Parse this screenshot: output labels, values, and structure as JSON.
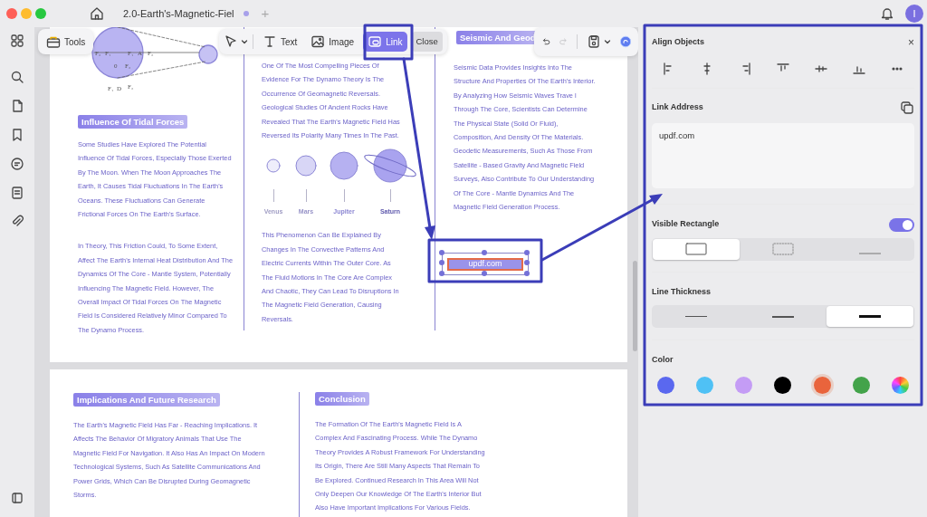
{
  "title_bar": {
    "tab_title": "2.0-Earth's-Magnetic-Fiel",
    "tab_unsaved": true,
    "new_tab": "+",
    "avatar_letter": "I"
  },
  "toolbar": {
    "tools_label": "Tools",
    "modes": [
      {
        "kind": "text",
        "label": "Text",
        "selected": false
      },
      {
        "kind": "image",
        "label": "Image",
        "selected": false
      },
      {
        "kind": "link",
        "label": "Link",
        "selected": true
      }
    ],
    "close_label": "Close",
    "redo_disabled": true
  },
  "pages": [
    {
      "columns": [
        {
          "blocks": [
            {
              "kind": "figure",
              "labels": [
                "F₂",
                "F₁",
                "F₁",
                "A",
                "F₂",
                "0",
                "F₂",
                "F₁",
                "D",
                "F₂"
              ]
            },
            {
              "kind": "heading",
              "text": "Influence Of Tidal Forces"
            },
            {
              "kind": "paragraph",
              "text": "Some Studies Have Explored The Potential Influence Of Tidal Forces, Especially Those Exerted By The Moon. When The Moon Approaches The Earth, It Causes Tidal Fluctuations In The Earth's Oceans. These Fluctuations Can Generate Frictional Forces On The Earth's Surface."
            },
            {
              "kind": "paragraph",
              "text": "In Theory, This Friction Could, To Some Extent, Affect The Earth's Internal Heat Distribution And The Dynamics Of The Core - Mantle System, Potentially Influencing The Magnetic Field. However, The Overall Impact Of Tidal Forces On The Magnetic Field Is Considered Relatively Minor Compared To The Dynamo Process."
            }
          ]
        },
        {
          "blocks": [
            {
              "kind": "paragraph",
              "text": "One Of The Most Compelling Pieces Of Evidence For The Dynamo Theory Is The Occurrence Of Geomagnetic Reversals. Geological Studies Of Ancient Rocks Have Revealed That The Earth's Magnetic Field Has Reversed Its Polarity Many Times In The Past."
            },
            {
              "kind": "planets",
              "planets": [
                {
                  "name": "Venus",
                  "ringed": false
                },
                {
                  "name": "Mars",
                  "ringed": false
                },
                {
                  "name": "Jupiter",
                  "ringed": false
                },
                {
                  "name": "Saturn",
                  "ringed": true
                }
              ]
            },
            {
              "kind": "paragraph",
              "text": "This Phenomenon Can Be Explained By Changes In The Convective Patterns And Electric Currents Within The Outer Core. As The Fluid Motions In The Core Are Complex And Chaotic, They Can Lead To Disruptions In The Magnetic Field Generation, Causing Reversals."
            }
          ]
        },
        {
          "blocks": [
            {
              "kind": "heading",
              "text": "Seismic And Geod"
            },
            {
              "kind": "paragraph",
              "text": "Seismic Data Provides Insights Into The Structure And Properties Of The Earth's Interior. By Analyzing How Seismic Waves Trave l Through The Core, Scientists Can Determine The Physical State (Solid Or Fluid), Composition, And Density Of The Materials. Geodetic Measurements, Such As Those From Satellite - Based Gravity And Magnetic Field Surveys, Also Contribute To Our Understanding Of The Core - Mantle Dynamics And The Magnetic Field Generation Process."
            },
            {
              "kind": "link",
              "text": "updf.com",
              "selected": true
            }
          ]
        }
      ]
    },
    {
      "columns": [
        {
          "blocks": [
            {
              "kind": "heading",
              "text": "Implications And Future Research"
            },
            {
              "kind": "paragraph",
              "text": "The Earth's Magnetic Field Has Far - Reaching Implications. It Affects The Behavior Of Migratory Animals That Use The Magnetic Field For Navigation. It Also Has An Impact On Modern Technological Systems, Such As Satellite Communications And Power Grids, Which Can Be Disrupted During Geomagnetic Storms."
            }
          ]
        },
        {
          "blocks": [
            {
              "kind": "heading",
              "text": "Conclusion"
            },
            {
              "kind": "paragraph",
              "text": "The Formation Of The Earth's Magnetic Field Is A Complex And Fascinating Process. While The Dynamo Theory Provides A Robust Framework For Understanding Its Origin, There Are Still Many Aspects That Remain To Be Explored. Continued Research In This Area Will Not Only Deepen Our Knowledge Of The Earth's Interior But Also Have Important Implications For Various Fields."
            }
          ]
        }
      ]
    }
  ],
  "panel": {
    "title": "Align Objects",
    "close": "×",
    "link_label": "Link Address",
    "link_value": "updf.com",
    "rect_label": "Visible Rectangle",
    "rect_on": true,
    "rect_styles": [
      {
        "kind": "solid",
        "selected": true
      },
      {
        "kind": "dashed",
        "selected": false
      },
      {
        "kind": "underline",
        "selected": false
      }
    ],
    "thickness_label": "Line Thickness",
    "thickness": [
      {
        "kind": "thin",
        "selected": false
      },
      {
        "kind": "medium",
        "selected": false
      },
      {
        "kind": "thick",
        "selected": true
      }
    ],
    "color_label": "Color",
    "colors": [
      {
        "kind": "swatch",
        "color": "#5a68ef",
        "selected": false
      },
      {
        "kind": "swatch",
        "color": "#4fc1f5",
        "selected": false
      },
      {
        "kind": "swatch",
        "color": "#c49cf5",
        "selected": false
      },
      {
        "kind": "swatch",
        "color": "#000000",
        "selected": false
      },
      {
        "kind": "swatch",
        "color": "#e9643c",
        "selected": true
      },
      {
        "kind": "swatch",
        "color": "#43a34a",
        "selected": false
      },
      {
        "kind": "spectrum",
        "selected": false
      }
    ]
  }
}
